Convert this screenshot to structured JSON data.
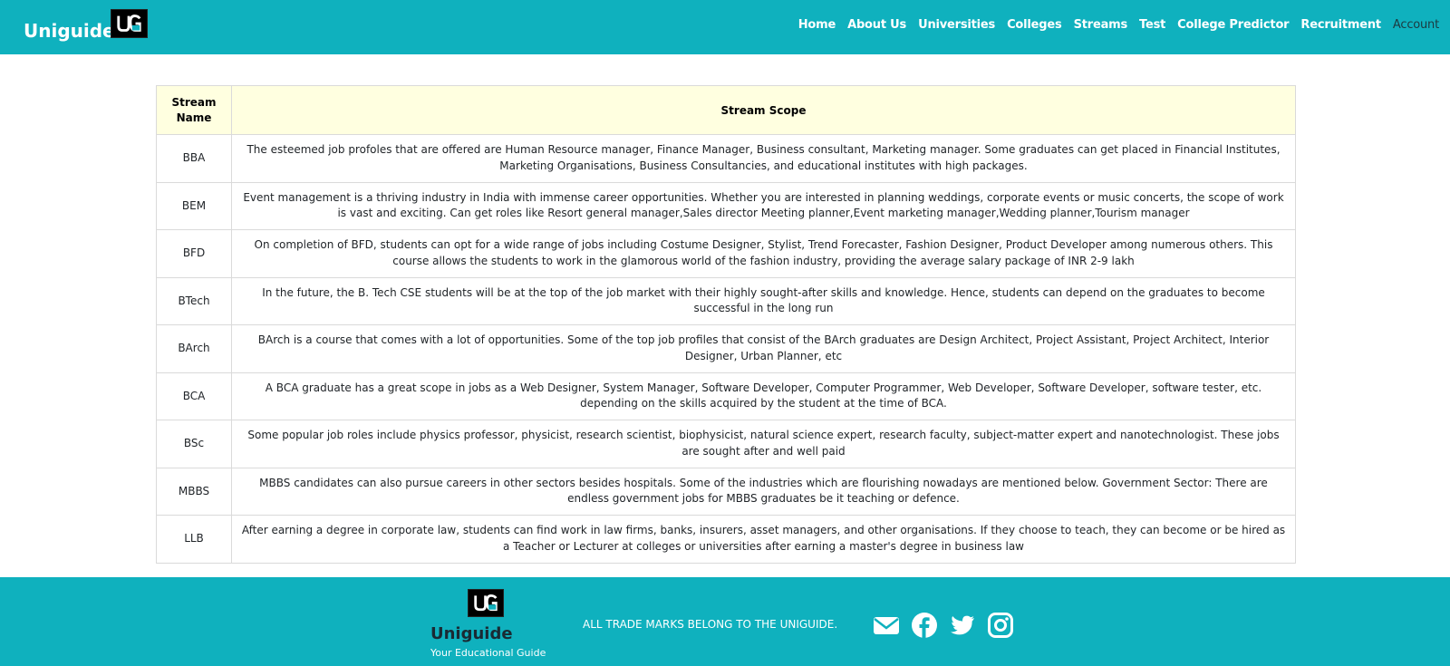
{
  "header": {
    "brand": "Uniguide",
    "logo_text": "UG",
    "nav": [
      "Home",
      "About Us",
      "Universities",
      "Colleges",
      "Streams",
      "Test",
      "College Predictor",
      "Recruitment"
    ],
    "account": "Account"
  },
  "table": {
    "headers": {
      "name": "Stream Name",
      "scope": "Stream Scope"
    },
    "rows": [
      {
        "name": "BBA",
        "scope": "The esteemed job profoles that are offered are Human Resource manager, Finance Manager, Business consultant, Marketing manager. Some graduates can get placed in Financial Institutes, Marketing Organisations, Business Consultancies, and educational institutes with high packages."
      },
      {
        "name": "BEM",
        "scope": "Event management is a thriving industry in India with immense career opportunities. Whether you are interested in planning weddings, corporate events or music concerts, the scope of work is vast and exciting. Can get roles like Resort general manager,Sales director Meeting planner,Event marketing manager,Wedding planner,Tourism manager"
      },
      {
        "name": "BFD",
        "scope": "On completion of BFD, students can opt for a wide range of jobs including Costume Designer, Stylist, Trend Forecaster, Fashion Designer, Product Developer among numerous others. This course allows the students to work in the glamorous world of the fashion industry, providing the average salary package of INR 2-9 lakh"
      },
      {
        "name": "BTech",
        "scope": "In the future, the B. Tech CSE students will be at the top of the job market with their highly sought-after skills and knowledge. Hence, students can depend on the graduates to become successful in the long run"
      },
      {
        "name": "BArch",
        "scope": "BArch is a course that comes with a lot of opportunities. Some of the top job profiles that consist of the BArch graduates are Design Architect, Project Assistant, Project Architect, Interior Designer, Urban Planner, etc"
      },
      {
        "name": "BCA",
        "scope": "A BCA graduate has a great scope in jobs as a Web Designer, System Manager, Software Developer, Computer Programmer, Web Developer, Software Developer, software tester, etc. depending on the skills acquired by the student at the time of BCA."
      },
      {
        "name": "BSc",
        "scope": "Some popular job roles include physics professor, physicist, research scientist, biophysicist, natural science expert, research faculty, subject-matter expert and nanotechnologist. These jobs are sought after and well paid"
      },
      {
        "name": "MBBS",
        "scope": "MBBS candidates can also pursue careers in other sectors besides hospitals. Some of the industries which are flourishing nowadays are mentioned below. Government Sector: There are endless government jobs for MBBS graduates be it teaching or defence."
      },
      {
        "name": "LLB",
        "scope": "After earning a degree in corporate law, students can find work in law firms, banks, insurers, asset managers, and other organisations. If they choose to teach, they can become or be hired as a Teacher or Lecturer at colleges or universities after earning a master's degree in business law"
      }
    ]
  },
  "footer": {
    "brand": "Uniguide",
    "tagline": "Your Educational Guide",
    "trademark": "ALL TRADE MARKS BELONG TO THE UNIGUIDE.",
    "social_icons": [
      "envelope-icon",
      "facebook-icon",
      "twitter-icon",
      "instagram-icon"
    ]
  },
  "colors": {
    "primary": "#0fb1be",
    "header_cell": "#ffffe0"
  }
}
